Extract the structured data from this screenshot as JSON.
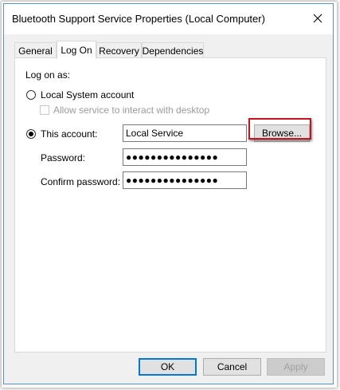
{
  "window": {
    "title": "Bluetooth Support Service Properties (Local Computer)"
  },
  "tabs": [
    {
      "label": "General",
      "active": false
    },
    {
      "label": "Log On",
      "active": true
    },
    {
      "label": "Recovery",
      "active": false
    },
    {
      "label": "Dependencies",
      "active": false
    }
  ],
  "logon": {
    "heading": "Log on as:",
    "local_system_label": "Local System account",
    "local_system_checked": false,
    "interact_label": "Allow service to interact with desktop",
    "interact_checked": false,
    "this_account_label": "This account:",
    "this_account_checked": true,
    "account_value": "Local Service",
    "browse_label": "Browse...",
    "password_label": "Password:",
    "password_value": "●●●●●●●●●●●●●●●",
    "confirm_label": "Confirm password:",
    "confirm_value": "●●●●●●●●●●●●●●●"
  },
  "footer": {
    "ok_label": "OK",
    "cancel_label": "Cancel",
    "apply_label": "Apply"
  },
  "colors": {
    "highlight_border": "#c8141e",
    "window_border": "#5a8ecf",
    "default_button_border": "#0078d7"
  },
  "icons": {
    "close": "close-icon"
  }
}
